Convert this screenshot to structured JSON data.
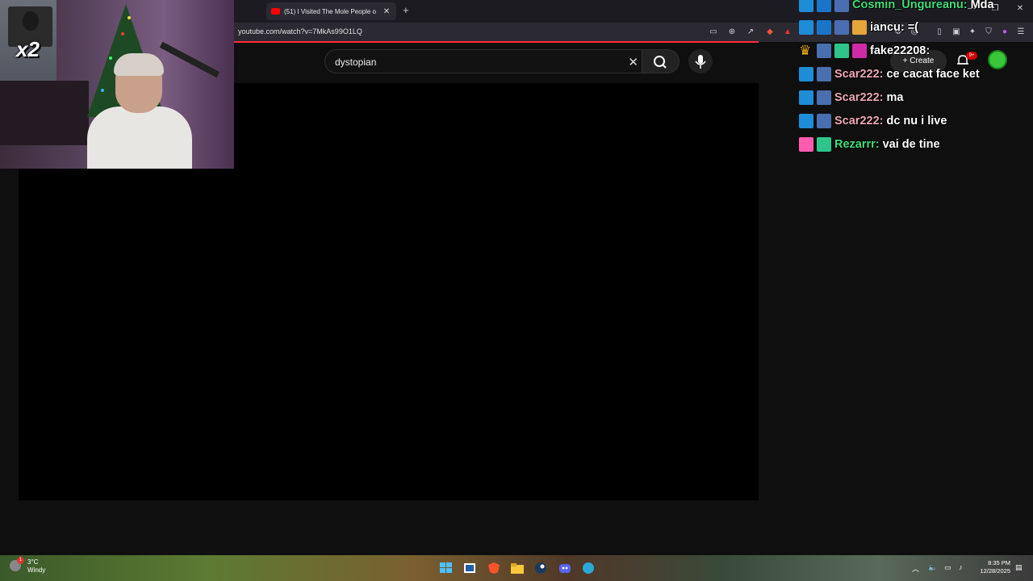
{
  "browser": {
    "tab_title": "(51) I Visited The Mole People o",
    "tab_close": "✕",
    "new_tab": "+",
    "url": "youtube.com/watch?v=7MkAs99O1LQ"
  },
  "youtube": {
    "search_value": "dystopian",
    "clear_icon": "✕",
    "create_label": "Create",
    "notif_count": "9+"
  },
  "overlay": {
    "multiplier": "x2"
  },
  "chat": [
    {
      "badges": [
        "mod",
        "vip",
        "helper"
      ],
      "user": "Cosmin_Ungureanu:",
      "user_color": "#3fe07a",
      "msg": "Mda"
    },
    {
      "badges": [
        "mod",
        "vip",
        "helper",
        "sub"
      ],
      "user": "iancu:",
      "user_color": "#ffffff",
      "msg": "=("
    },
    {
      "badges": [
        "crown",
        "helper",
        "gift",
        "pink"
      ],
      "user": "fake22208:",
      "user_color": "#ffffff",
      "msg": ""
    },
    {
      "badges": [
        "mod",
        "helper"
      ],
      "user": "Scar222:",
      "user_color": "#f0a8b8",
      "msg": "ce cacat face ket"
    },
    {
      "badges": [
        "mod",
        "helper"
      ],
      "user": "Scar222:",
      "user_color": "#f0a8b8",
      "msg": "ma"
    },
    {
      "badges": [
        "mod",
        "helper"
      ],
      "user": "Scar222:",
      "user_color": "#f0a8b8",
      "msg": "dc nu i live"
    },
    {
      "badges": [
        "alien",
        "gift"
      ],
      "user": "Rezarrr:",
      "user_color": "#3fe07a",
      "msg": "vai de tine"
    }
  ],
  "taskbar": {
    "temp": "3°C",
    "weather": "Windy",
    "weather_badge": "1",
    "time": "8:35 PM",
    "date": "12/28/2025"
  }
}
